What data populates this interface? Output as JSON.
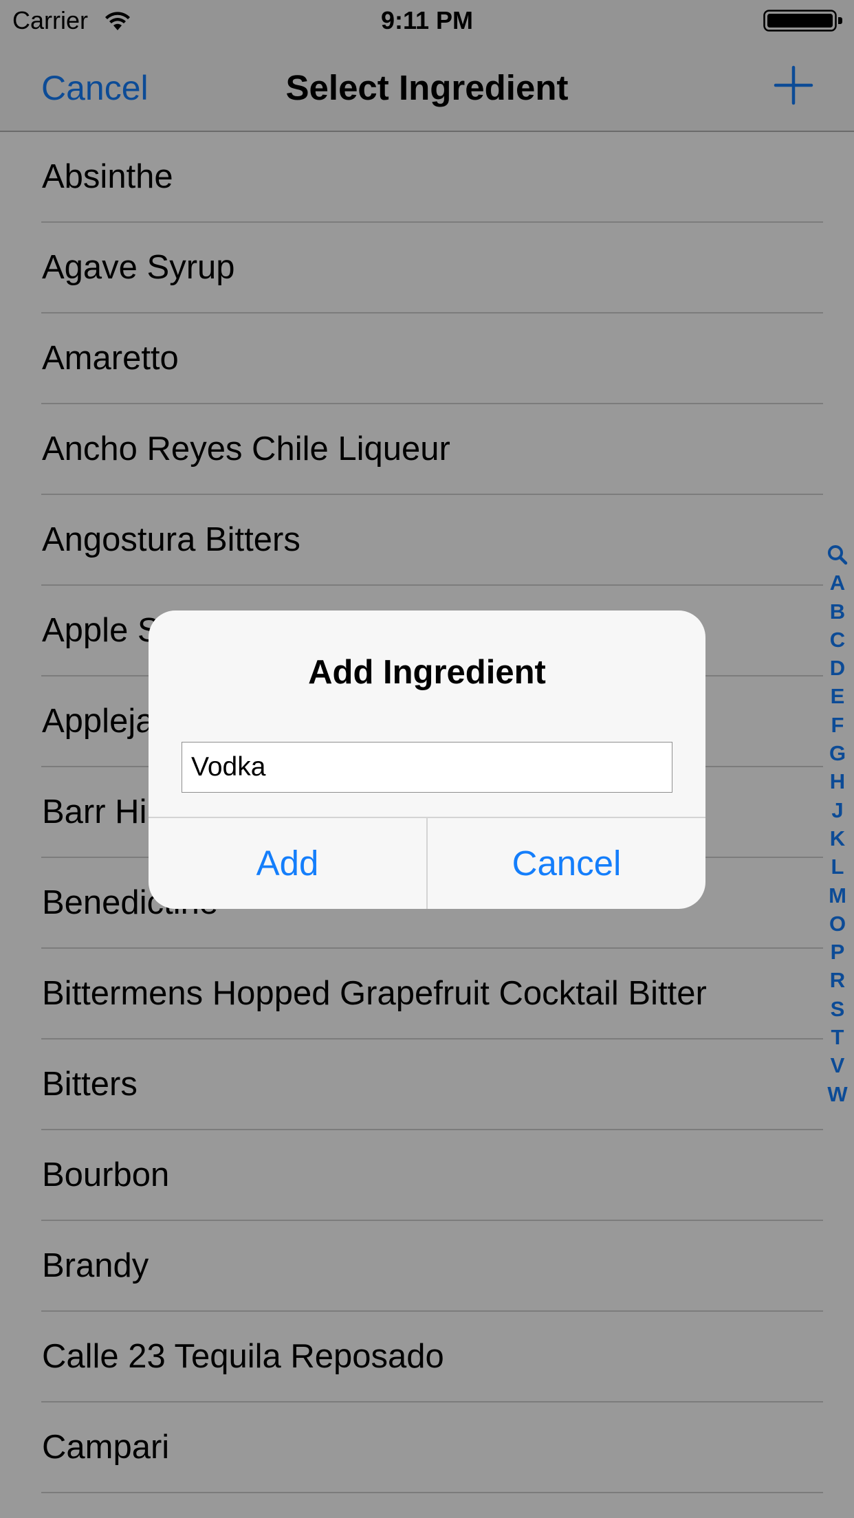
{
  "status_bar": {
    "carrier": "Carrier",
    "time": "9:11 PM",
    "wifi_icon": "wifi-icon",
    "battery_icon": "battery-icon"
  },
  "nav": {
    "cancel_label": "Cancel",
    "title": "Select Ingredient",
    "add_icon": "plus-icon"
  },
  "ingredients": [
    "Absinthe",
    "Agave Syrup",
    "Amaretto",
    "Ancho Reyes Chile Liqueur",
    "Angostura Bitters",
    "Apple Schnapps",
    "Applejack",
    "Barr Hill Gin",
    "Benedictine",
    "Bittermens Hopped Grapefruit Cocktail Bitter",
    "Bitters",
    "Bourbon",
    "Brandy",
    "Calle 23 Tequila Reposado",
    "Campari"
  ],
  "section_index": [
    "A",
    "B",
    "C",
    "D",
    "E",
    "F",
    "G",
    "H",
    "J",
    "K",
    "L",
    "M",
    "O",
    "P",
    "R",
    "S",
    "T",
    "V",
    "W"
  ],
  "alert": {
    "title": "Add Ingredient",
    "input_value": "Vodka",
    "add_label": "Add",
    "cancel_label": "Cancel"
  },
  "colors": {
    "accent": "#147efb",
    "bar_background": "#f7f7f7",
    "dim": "rgba(0,0,0,0.4)"
  }
}
